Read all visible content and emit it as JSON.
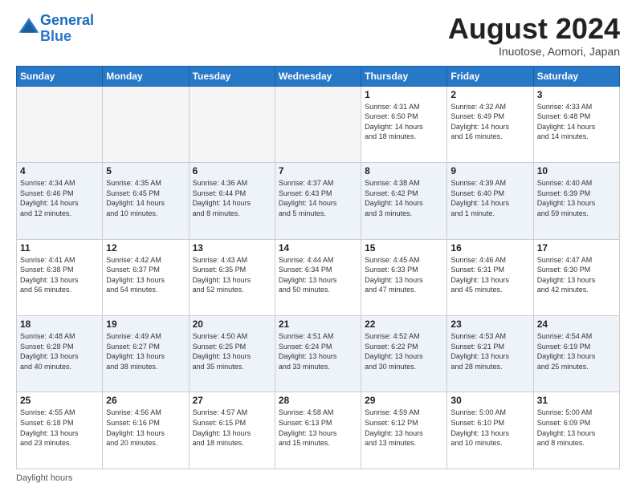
{
  "logo": {
    "text_general": "General",
    "text_blue": "Blue"
  },
  "header": {
    "title": "August 2024",
    "subtitle": "Inuotose, Aomori, Japan"
  },
  "weekdays": [
    "Sunday",
    "Monday",
    "Tuesday",
    "Wednesday",
    "Thursday",
    "Friday",
    "Saturday"
  ],
  "footer": {
    "daylight_label": "Daylight hours"
  },
  "weeks": [
    [
      {
        "day": "",
        "info": ""
      },
      {
        "day": "",
        "info": ""
      },
      {
        "day": "",
        "info": ""
      },
      {
        "day": "",
        "info": ""
      },
      {
        "day": "1",
        "info": "Sunrise: 4:31 AM\nSunset: 6:50 PM\nDaylight: 14 hours\nand 18 minutes."
      },
      {
        "day": "2",
        "info": "Sunrise: 4:32 AM\nSunset: 6:49 PM\nDaylight: 14 hours\nand 16 minutes."
      },
      {
        "day": "3",
        "info": "Sunrise: 4:33 AM\nSunset: 6:48 PM\nDaylight: 14 hours\nand 14 minutes."
      }
    ],
    [
      {
        "day": "4",
        "info": "Sunrise: 4:34 AM\nSunset: 6:46 PM\nDaylight: 14 hours\nand 12 minutes."
      },
      {
        "day": "5",
        "info": "Sunrise: 4:35 AM\nSunset: 6:45 PM\nDaylight: 14 hours\nand 10 minutes."
      },
      {
        "day": "6",
        "info": "Sunrise: 4:36 AM\nSunset: 6:44 PM\nDaylight: 14 hours\nand 8 minutes."
      },
      {
        "day": "7",
        "info": "Sunrise: 4:37 AM\nSunset: 6:43 PM\nDaylight: 14 hours\nand 5 minutes."
      },
      {
        "day": "8",
        "info": "Sunrise: 4:38 AM\nSunset: 6:42 PM\nDaylight: 14 hours\nand 3 minutes."
      },
      {
        "day": "9",
        "info": "Sunrise: 4:39 AM\nSunset: 6:40 PM\nDaylight: 14 hours\nand 1 minute."
      },
      {
        "day": "10",
        "info": "Sunrise: 4:40 AM\nSunset: 6:39 PM\nDaylight: 13 hours\nand 59 minutes."
      }
    ],
    [
      {
        "day": "11",
        "info": "Sunrise: 4:41 AM\nSunset: 6:38 PM\nDaylight: 13 hours\nand 56 minutes."
      },
      {
        "day": "12",
        "info": "Sunrise: 4:42 AM\nSunset: 6:37 PM\nDaylight: 13 hours\nand 54 minutes."
      },
      {
        "day": "13",
        "info": "Sunrise: 4:43 AM\nSunset: 6:35 PM\nDaylight: 13 hours\nand 52 minutes."
      },
      {
        "day": "14",
        "info": "Sunrise: 4:44 AM\nSunset: 6:34 PM\nDaylight: 13 hours\nand 50 minutes."
      },
      {
        "day": "15",
        "info": "Sunrise: 4:45 AM\nSunset: 6:33 PM\nDaylight: 13 hours\nand 47 minutes."
      },
      {
        "day": "16",
        "info": "Sunrise: 4:46 AM\nSunset: 6:31 PM\nDaylight: 13 hours\nand 45 minutes."
      },
      {
        "day": "17",
        "info": "Sunrise: 4:47 AM\nSunset: 6:30 PM\nDaylight: 13 hours\nand 42 minutes."
      }
    ],
    [
      {
        "day": "18",
        "info": "Sunrise: 4:48 AM\nSunset: 6:28 PM\nDaylight: 13 hours\nand 40 minutes."
      },
      {
        "day": "19",
        "info": "Sunrise: 4:49 AM\nSunset: 6:27 PM\nDaylight: 13 hours\nand 38 minutes."
      },
      {
        "day": "20",
        "info": "Sunrise: 4:50 AM\nSunset: 6:25 PM\nDaylight: 13 hours\nand 35 minutes."
      },
      {
        "day": "21",
        "info": "Sunrise: 4:51 AM\nSunset: 6:24 PM\nDaylight: 13 hours\nand 33 minutes."
      },
      {
        "day": "22",
        "info": "Sunrise: 4:52 AM\nSunset: 6:22 PM\nDaylight: 13 hours\nand 30 minutes."
      },
      {
        "day": "23",
        "info": "Sunrise: 4:53 AM\nSunset: 6:21 PM\nDaylight: 13 hours\nand 28 minutes."
      },
      {
        "day": "24",
        "info": "Sunrise: 4:54 AM\nSunset: 6:19 PM\nDaylight: 13 hours\nand 25 minutes."
      }
    ],
    [
      {
        "day": "25",
        "info": "Sunrise: 4:55 AM\nSunset: 6:18 PM\nDaylight: 13 hours\nand 23 minutes."
      },
      {
        "day": "26",
        "info": "Sunrise: 4:56 AM\nSunset: 6:16 PM\nDaylight: 13 hours\nand 20 minutes."
      },
      {
        "day": "27",
        "info": "Sunrise: 4:57 AM\nSunset: 6:15 PM\nDaylight: 13 hours\nand 18 minutes."
      },
      {
        "day": "28",
        "info": "Sunrise: 4:58 AM\nSunset: 6:13 PM\nDaylight: 13 hours\nand 15 minutes."
      },
      {
        "day": "29",
        "info": "Sunrise: 4:59 AM\nSunset: 6:12 PM\nDaylight: 13 hours\nand 13 minutes."
      },
      {
        "day": "30",
        "info": "Sunrise: 5:00 AM\nSunset: 6:10 PM\nDaylight: 13 hours\nand 10 minutes."
      },
      {
        "day": "31",
        "info": "Sunrise: 5:00 AM\nSunset: 6:09 PM\nDaylight: 13 hours\nand 8 minutes."
      }
    ]
  ]
}
